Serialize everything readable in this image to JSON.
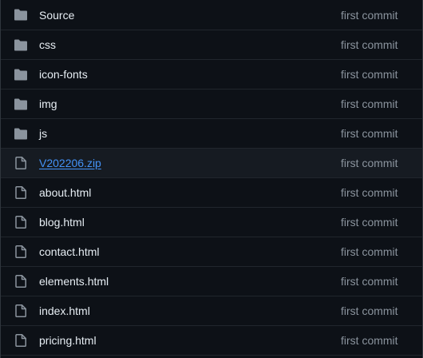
{
  "files": [
    {
      "name": "Source",
      "type": "folder",
      "commit": "first commit"
    },
    {
      "name": "css",
      "type": "folder",
      "commit": "first commit"
    },
    {
      "name": "icon-fonts",
      "type": "folder",
      "commit": "first commit"
    },
    {
      "name": "img",
      "type": "folder",
      "commit": "first commit"
    },
    {
      "name": "js",
      "type": "folder",
      "commit": "first commit"
    },
    {
      "name": "V202206.zip",
      "type": "file",
      "commit": "first commit",
      "highlighted": true
    },
    {
      "name": "about.html",
      "type": "file",
      "commit": "first commit"
    },
    {
      "name": "blog.html",
      "type": "file",
      "commit": "first commit"
    },
    {
      "name": "contact.html",
      "type": "file",
      "commit": "first commit"
    },
    {
      "name": "elements.html",
      "type": "file",
      "commit": "first commit"
    },
    {
      "name": "index.html",
      "type": "file",
      "commit": "first commit"
    },
    {
      "name": "pricing.html",
      "type": "file",
      "commit": "first commit"
    }
  ],
  "icons": {
    "folder": "folder-icon",
    "file": "file-icon"
  },
  "colors": {
    "background": "#0d1117",
    "row_highlight": "#161b22",
    "text": "#e6edf3",
    "link": "#4493f8",
    "muted": "#8b949e",
    "icon": "#8b949e",
    "divider": "#21262d"
  }
}
